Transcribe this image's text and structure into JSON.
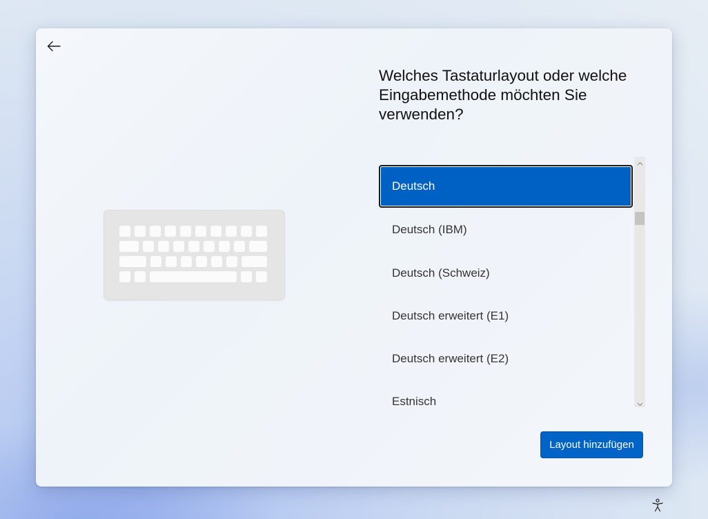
{
  "window": {
    "title": "Welches Tastaturlayout oder welche Eingabemethode möchten Sie verwenden?"
  },
  "navigation": {
    "back_icon": "arrow-left-icon"
  },
  "illustration": {
    "icon": "keyboard-illustration"
  },
  "layout_list": {
    "items": [
      {
        "label": "Deutsch",
        "selected": true
      },
      {
        "label": "Deutsch (IBM)",
        "selected": false
      },
      {
        "label": "Deutsch (Schweiz)",
        "selected": false
      },
      {
        "label": "Deutsch erweitert (E1)",
        "selected": false
      },
      {
        "label": "Deutsch erweitert (E2)",
        "selected": false
      },
      {
        "label": "Estnisch",
        "selected": false
      }
    ],
    "scrollbar": {
      "up_icon": "chevron-up-icon",
      "down_icon": "chevron-down-icon"
    }
  },
  "actions": {
    "primary_label": "Layout hinzufügen"
  },
  "taskbar": {
    "accessibility_icon": "accessibility-icon"
  },
  "colors": {
    "accent": "#0063c6",
    "selected_item": "#0061c4",
    "text": "#111111",
    "keyboard_body": "#e5e5e5",
    "keyboard_keys": "#fbfbfb"
  }
}
